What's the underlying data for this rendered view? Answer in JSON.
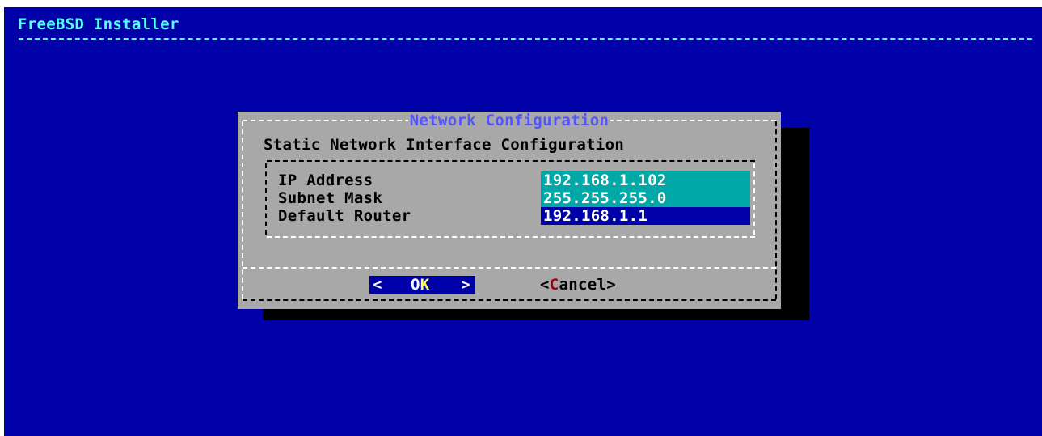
{
  "backtitle": "FreeBSD Installer",
  "dialog": {
    "title": "Network Configuration",
    "subtitle": "Static Network Interface Configuration",
    "fields": [
      {
        "label": "IP Address",
        "value": "192.168.1.102",
        "state": "inactive"
      },
      {
        "label": "Subnet Mask",
        "value": "255.255.255.0",
        "state": "inactive"
      },
      {
        "label": "Default Router",
        "value": "192.168.1.1",
        "state": "active"
      }
    ],
    "buttons": {
      "ok": {
        "left": "<",
        "label_pre": "O",
        "label_hot": "K",
        "right": ">",
        "selected": true
      },
      "cancel": {
        "open": "<",
        "label_hot": "C",
        "label_post": "ancel",
        "close": ">",
        "selected": false
      }
    }
  },
  "colors": {
    "screen_bg": "#0000a8",
    "dialog_bg": "#a8a8a8",
    "backtitle": "#55ffff",
    "title": "#5454ff",
    "field_inactive": "#00a8a8",
    "field_active": "#0000a8",
    "hotkey_selected": "#ffff55",
    "hotkey_unselected": "#a80000"
  }
}
